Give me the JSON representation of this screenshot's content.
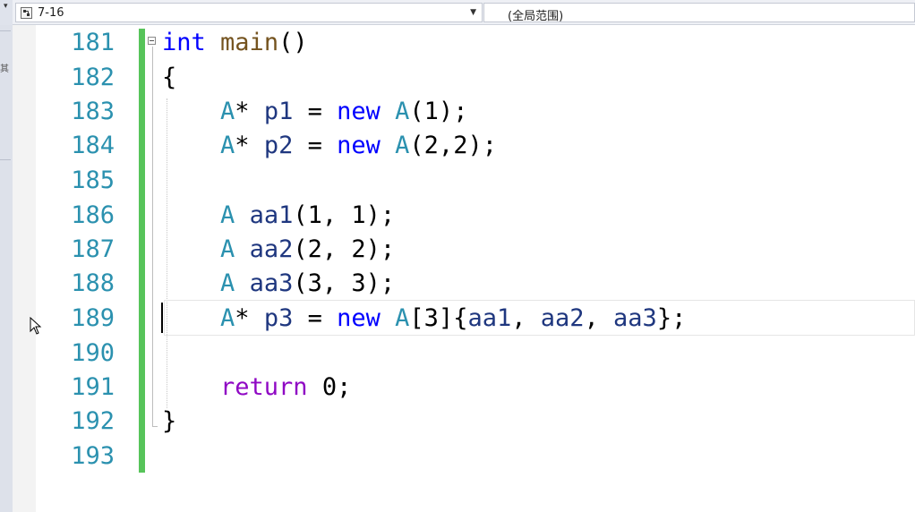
{
  "navbar": {
    "left_strip_glyph": "▾",
    "project_combo": "7-16",
    "scope_combo": "(全局范围)",
    "dropdown_glyph": "▼"
  },
  "left_chrome": {
    "glyph": "其"
  },
  "colors": {
    "keyword": "#0000ff",
    "type": "#2b91af",
    "function": "#74531f",
    "variable": "#1f377f",
    "control": "#8f08c4",
    "line_number": "#2b91af",
    "change_bar": "#57c45a"
  },
  "editor": {
    "lines": [
      {
        "num": "181",
        "t": [
          [
            "kw",
            "int"
          ],
          [
            "punc",
            " "
          ],
          [
            "fn",
            "main"
          ],
          [
            "punc",
            "()"
          ]
        ]
      },
      {
        "num": "182",
        "t": [
          [
            "punc",
            "{"
          ]
        ]
      },
      {
        "num": "183",
        "t": [
          [
            "punc",
            "    "
          ],
          [
            "type",
            "A"
          ],
          [
            "punc",
            "* "
          ],
          [
            "var",
            "p1"
          ],
          [
            "punc",
            " = "
          ],
          [
            "kw",
            "new"
          ],
          [
            "punc",
            " "
          ],
          [
            "type",
            "A"
          ],
          [
            "punc",
            "(1);"
          ]
        ]
      },
      {
        "num": "184",
        "t": [
          [
            "punc",
            "    "
          ],
          [
            "type",
            "A"
          ],
          [
            "punc",
            "* "
          ],
          [
            "var",
            "p2"
          ],
          [
            "punc",
            " = "
          ],
          [
            "kw",
            "new"
          ],
          [
            "punc",
            " "
          ],
          [
            "type",
            "A"
          ],
          [
            "punc",
            "(2,2);"
          ]
        ]
      },
      {
        "num": "185",
        "t": []
      },
      {
        "num": "186",
        "t": [
          [
            "punc",
            "    "
          ],
          [
            "type",
            "A"
          ],
          [
            "punc",
            " "
          ],
          [
            "var",
            "aa1"
          ],
          [
            "punc",
            "(1, 1);"
          ]
        ]
      },
      {
        "num": "187",
        "t": [
          [
            "punc",
            "    "
          ],
          [
            "type",
            "A"
          ],
          [
            "punc",
            " "
          ],
          [
            "var",
            "aa2"
          ],
          [
            "punc",
            "(2, 2);"
          ]
        ]
      },
      {
        "num": "188",
        "t": [
          [
            "punc",
            "    "
          ],
          [
            "type",
            "A"
          ],
          [
            "punc",
            " "
          ],
          [
            "var",
            "aa3"
          ],
          [
            "punc",
            "(3, 3);"
          ]
        ]
      },
      {
        "num": "189",
        "t": [
          [
            "punc",
            "    "
          ],
          [
            "type",
            "A"
          ],
          [
            "punc",
            "* "
          ],
          [
            "var",
            "p3"
          ],
          [
            "punc",
            " = "
          ],
          [
            "kw",
            "new"
          ],
          [
            "punc",
            " "
          ],
          [
            "type",
            "A"
          ],
          [
            "punc",
            "[3]{"
          ],
          [
            "var",
            "aa1"
          ],
          [
            "punc",
            ", "
          ],
          [
            "var",
            "aa2"
          ],
          [
            "punc",
            ", "
          ],
          [
            "var",
            "aa3"
          ],
          [
            "punc",
            "};"
          ]
        ]
      },
      {
        "num": "190",
        "t": []
      },
      {
        "num": "191",
        "t": [
          [
            "punc",
            "    "
          ],
          [
            "ctl",
            "return"
          ],
          [
            "punc",
            " 0;"
          ]
        ]
      },
      {
        "num": "192",
        "t": [
          [
            "punc",
            "}"
          ]
        ]
      },
      {
        "num": "193",
        "t": []
      }
    ]
  }
}
